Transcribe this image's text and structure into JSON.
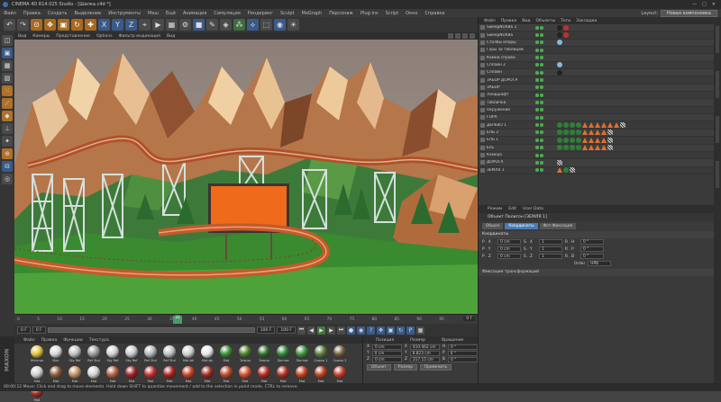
{
  "window": {
    "title": "CINEMA 4D R14.025 Studio - [Шапка.c4d *]",
    "menu": [
      "Файл",
      "Правка",
      "Создать",
      "Выделение",
      "Инструменты",
      "Меш",
      "Ещё",
      "Анимация",
      "Симуляция",
      "Рендеринг",
      "Sculpt",
      "MoGraph",
      "Персонаж",
      "Plug-ins",
      "Script",
      "Окно",
      "Справка"
    ],
    "layout_label": "Layout:",
    "layout_value": "Новая компоновка"
  },
  "object_manager": {
    "menu": [
      "Файл",
      "Правка",
      "Вид",
      "Объекты",
      "Теги",
      "Закладки"
    ],
    "objects": [
      {
        "name": "SweepNURBS 1",
        "tags": [
          "dark",
          "red"
        ]
      },
      {
        "name": "SweepNURBS",
        "tags": [
          "dark",
          "red"
        ]
      },
      {
        "name": "Столбы опоры",
        "tags": [
          "blue"
        ]
      },
      {
        "name": "Горы за таблицей",
        "tags": []
      },
      {
        "name": "Камни справа",
        "tags": []
      },
      {
        "name": "Сплайн 2",
        "tags": [
          "blue"
        ]
      },
      {
        "name": "Сплайн",
        "tags": [
          "dark"
        ]
      },
      {
        "name": "ЗАБОР ДОРОГА",
        "tags": []
      },
      {
        "name": "ЗАБОР",
        "tags": []
      },
      {
        "name": "Ландшафт",
        "tags": []
      },
      {
        "name": "Табличка",
        "tags": []
      },
      {
        "name": "Окружение",
        "tags": []
      },
      {
        "name": "ГОРА",
        "tags": []
      },
      {
        "name": "ДЕРЕВО 1",
        "tags": [
          "g",
          "g",
          "g",
          "g",
          "t",
          "t",
          "t",
          "t",
          "t",
          "t",
          "c"
        ]
      },
      {
        "name": "ЕЛЬ 2",
        "tags": [
          "g",
          "g",
          "g",
          "g",
          "t",
          "t",
          "t",
          "t",
          "c"
        ]
      },
      {
        "name": "ЕЛЬ 1",
        "tags": [
          "g",
          "g",
          "g",
          "g",
          "t",
          "t",
          "t",
          "t",
          "c"
        ]
      },
      {
        "name": "Ель",
        "tags": [
          "g",
          "g",
          "g",
          "g",
          "t",
          "t",
          "t",
          "t",
          "c"
        ]
      },
      {
        "name": "Камера",
        "tags": []
      },
      {
        "name": "ДОРОГА",
        "tags": [
          "c"
        ]
      },
      {
        "name": "ЗЕМЛЯ 1",
        "tags": [
          "t",
          "g",
          "c"
        ]
      }
    ]
  },
  "attributes": {
    "menu": [
      "Режим",
      "Edit",
      "User Data"
    ],
    "title": "Объект Полигон [ЗЕМЛЯ 1]",
    "tabs": [
      "Общее",
      "Координаты",
      "Фот.Фиксация"
    ],
    "section": "Координаты",
    "rows": [
      {
        "p": "P . X",
        "pv": "0 cm",
        "s": "S . X",
        "sv": "1",
        "r": "R . H",
        "rv": "0 °"
      },
      {
        "p": "P . Y",
        "pv": "0 cm",
        "s": "S . Y",
        "sv": "1",
        "r": "R . P",
        "rv": "0 °"
      },
      {
        "p": "P . Z",
        "pv": "0 cm",
        "s": "S . Z",
        "sv": "1",
        "r": "R . B",
        "rv": "0 °"
      }
    ],
    "order_label": "Order",
    "order_value": "HPB",
    "frozen": "Фиксация трансформаций"
  },
  "viewport": {
    "menu": [
      "Вид",
      "Камеры",
      "Представление",
      "Options",
      "Фильтр индикация",
      "Вид"
    ]
  },
  "timeline": {
    "ticks": [
      "0",
      "5",
      "10",
      "15",
      "20",
      "25",
      "30",
      "35",
      "40",
      "45",
      "50",
      "55",
      "60",
      "65",
      "70",
      "75",
      "80",
      "85",
      "90",
      "95"
    ],
    "current": "32",
    "end": "0 F"
  },
  "transport": {
    "start": "0 F",
    "current": "0 F",
    "max": "100 F",
    "end": "100 F"
  },
  "materials": {
    "menu": [
      "Файл",
      "Правка",
      "Функции",
      "Текстура"
    ],
    "items": [
      {
        "label": "Жёлтое",
        "color": "#e0c040"
      },
      {
        "label": "Мат",
        "color": "#d8d8d8"
      },
      {
        "label": "Sky Ref",
        "color": "#c0c0c0"
      },
      {
        "label": "Ref 3hd",
        "color": "#9a9a9a"
      },
      {
        "label": "Sky Ref",
        "color": "#d0d0d0"
      },
      {
        "label": "Sky Ref",
        "color": "#c8c8c8"
      },
      {
        "label": "Ref 3hd",
        "color": "#b5b5b5"
      },
      {
        "label": "Ref 3hd",
        "color": "#bfbfbf"
      },
      {
        "label": "Mat.bk",
        "color": "#cfcfcf"
      },
      {
        "label": "Mat.bk",
        "color": "#e6e6e6"
      },
      {
        "label": "Mat",
        "color": "#3a8a3a"
      },
      {
        "label": "Земля",
        "color": "#4a7a2a"
      },
      {
        "label": "Земля",
        "color": "#2e6a2e"
      },
      {
        "label": "Листва",
        "color": "#2f7f3a"
      },
      {
        "label": "Листва",
        "color": "#3e8e3e"
      },
      {
        "label": "Скалы 1",
        "color": "#5a7a3a"
      },
      {
        "label": "Скалы 2",
        "color": "#6b5a3a"
      },
      {
        "label": "Mat",
        "color": "#d0d0d0"
      },
      {
        "label": "Mat",
        "color": "#8a5a3a"
      },
      {
        "label": "Mat",
        "color": "#c09060"
      },
      {
        "label": "Mat",
        "color": "#d0d0d0"
      },
      {
        "label": "Mat",
        "color": "#b06040"
      },
      {
        "label": "Mat",
        "color": "#a02020"
      },
      {
        "label": "Mat",
        "color": "#c03030"
      },
      {
        "label": "Mat",
        "color": "#b02020"
      },
      {
        "label": "Mat",
        "color": "#c84020"
      },
      {
        "label": "Mat",
        "color": "#9a2a20"
      },
      {
        "label": "Mat",
        "color": "#b84a2a"
      },
      {
        "label": "Mat",
        "color": "#d05030"
      },
      {
        "label": "Mat",
        "color": "#b02a20"
      },
      {
        "label": "Mat",
        "color": "#a83020"
      },
      {
        "label": "Mat",
        "color": "#c04020"
      },
      {
        "label": "Mat",
        "color": "#b84020"
      },
      {
        "label": "Mat",
        "color": "#c03a2a"
      },
      {
        "label": "Mat",
        "color": "#a82a20"
      }
    ]
  },
  "coordinates": {
    "headers": [
      "Позиция",
      "Размер",
      "Вращение"
    ],
    "rows": [
      {
        "a": "X",
        "av": "0 cm",
        "b": "X",
        "bv": "410.462 cm",
        "c": "H",
        "cv": "0 °"
      },
      {
        "a": "Y",
        "av": "0 cm",
        "b": "Y",
        "bv": "8.823 cm",
        "c": "P",
        "cv": "0 °"
      },
      {
        "a": "Z",
        "av": "0 cm",
        "b": "Z",
        "bv": "217.15 cm",
        "c": "B",
        "cv": "0 °"
      }
    ],
    "mode1": "Объект",
    "mode2": "Размер",
    "apply": "Применить"
  },
  "status": {
    "text": "00:00:12   Move: Click and drag to move elements. Hold down SHIFT to quantize movement / add to the selection in point mode, CTRL to remove."
  },
  "brand": {
    "maxon": "MAXON"
  }
}
